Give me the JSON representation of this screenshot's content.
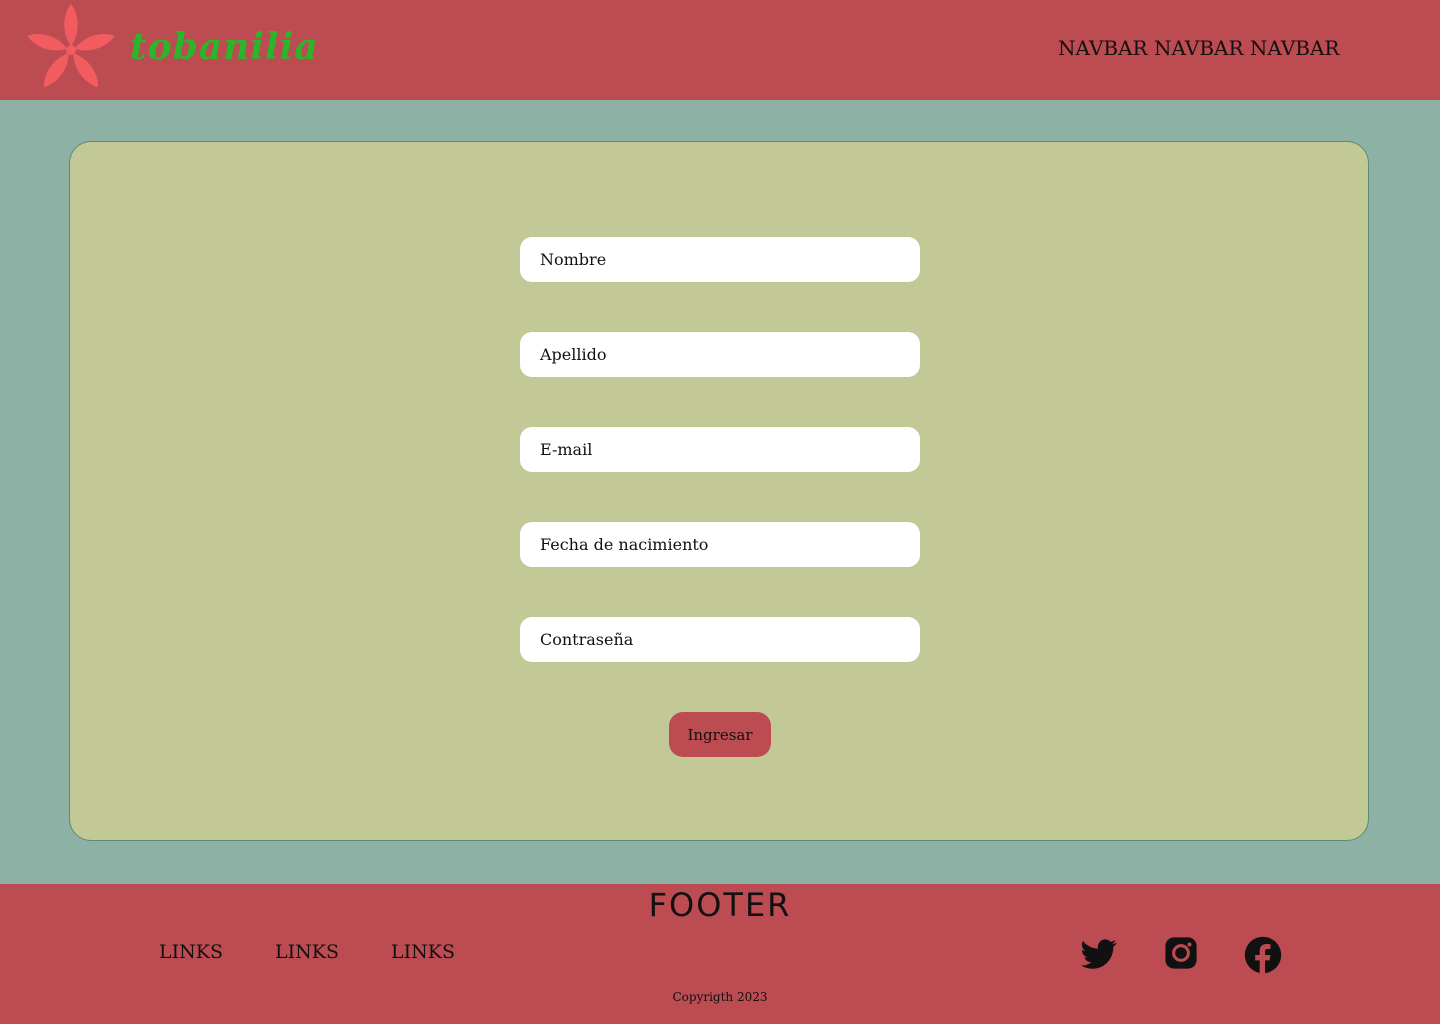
{
  "header": {
    "logo_text": "tobanilia",
    "logo_icon": "flower-icon",
    "navbar_text": "NAVBAR NAVBAR NAVBAR"
  },
  "form": {
    "fields": [
      {
        "placeholder": "Nombre"
      },
      {
        "placeholder": "Apellido"
      },
      {
        "placeholder": "E-mail"
      },
      {
        "placeholder": "Fecha de nacimiento"
      },
      {
        "placeholder": "Contraseña"
      }
    ],
    "submit_label": "Ingresar"
  },
  "footer": {
    "title": "FOOTER",
    "links": [
      "LINKS",
      "LINKS",
      "LINKS"
    ],
    "social_icons": [
      "twitter-icon",
      "instagram-icon",
      "facebook-icon"
    ],
    "copyright": "Copyrigth 2023"
  },
  "colors": {
    "brand_red": "#bc4b52",
    "page_background": "#8eb1a6",
    "card_background": "#c2c996",
    "logo_green": "#2bb52b",
    "flower_pink": "#f25c60"
  }
}
